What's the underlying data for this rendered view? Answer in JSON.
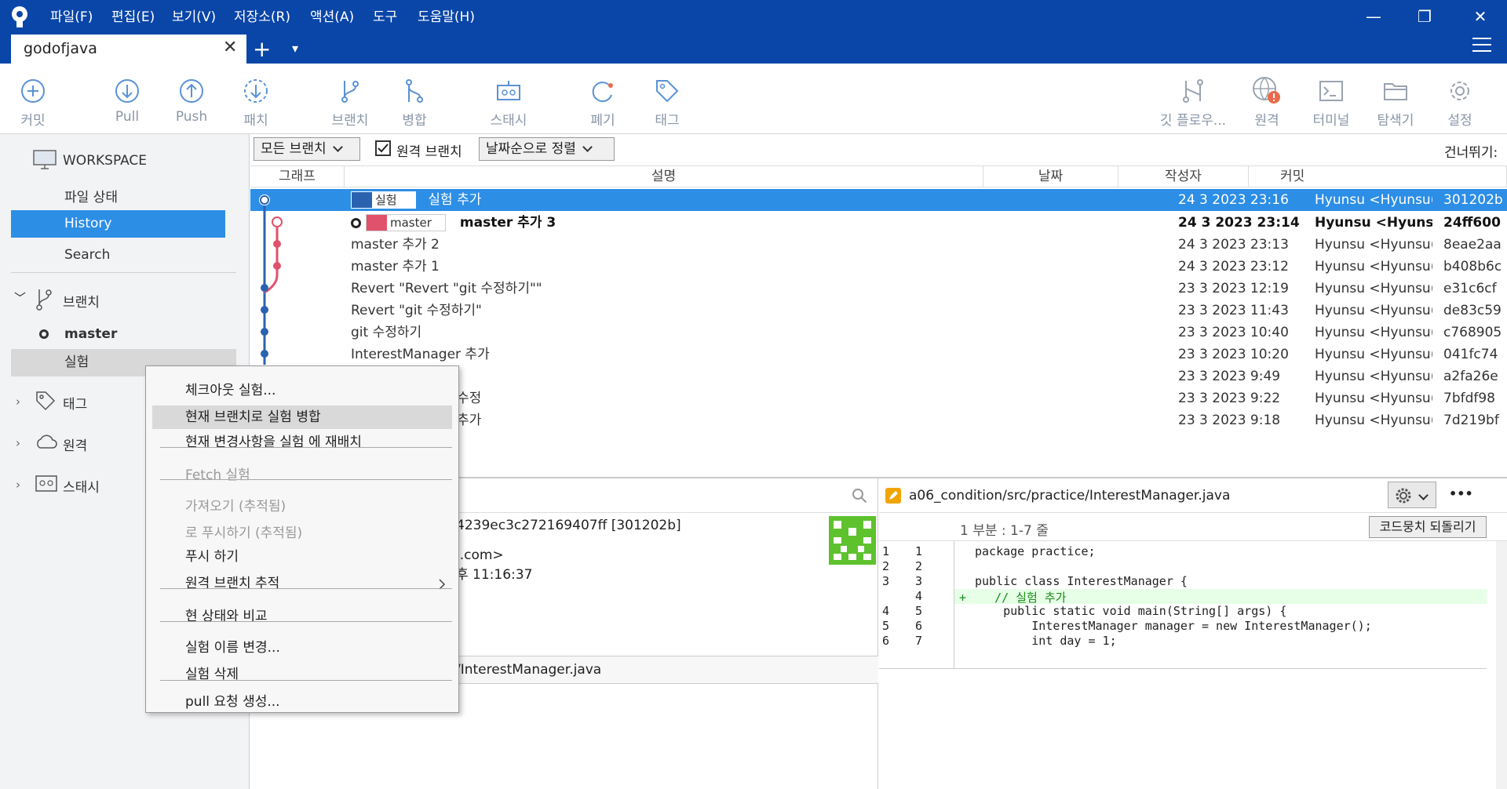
{
  "menu": [
    "파일(F)",
    "편집(E)",
    "보기(V)",
    "저장소(R)",
    "액션(A)",
    "도구",
    "도움말(H)"
  ],
  "tab": {
    "label": "godofjava",
    "close": "✕",
    "add": "+",
    "dropdown": "▾"
  },
  "window": {
    "minimize": "—",
    "restore": "❐",
    "close": "✕"
  },
  "toolbar": {
    "commit": "커밋",
    "pull": "Pull",
    "push": "Push",
    "patch": "패치",
    "branch": "브랜치",
    "merge": "병합",
    "stash": "스태시",
    "discard": "폐기",
    "tag": "태그",
    "gitflow": "깃 플로우...",
    "remote": "원격",
    "terminal": "터미널",
    "explorer": "탐색기",
    "settings": "설정"
  },
  "sidebar": {
    "workspace": "WORKSPACE",
    "file_status": "파일 상태",
    "history": "History",
    "search": "Search",
    "branches": "브랜치",
    "branch_master": "master",
    "branch_silheom": "실험",
    "tags": "태그",
    "remotes": "원격",
    "stashes": "스태시"
  },
  "filter": {
    "all_branches": "모든 브랜치",
    "remote_branches": "원격 브랜치",
    "sort": "날짜순으로 정렬",
    "skip": "건너뛰기:"
  },
  "columns": {
    "graph": "그래프",
    "description": "설명",
    "date": "날짜",
    "author": "작성자",
    "commit": "커밋"
  },
  "commits": [
    {
      "branch_tag": "실험",
      "desc": "실험 추가",
      "date": "24 3 2023 23:16",
      "author": "Hyunsu <Hyunsu(",
      "hash": "301202b"
    },
    {
      "branch_tag": "master",
      "desc": "master 추가 3",
      "date": "24 3 2023 23:14",
      "author": "Hyunsu <Hyunsu",
      "hash": "24ff600"
    },
    {
      "desc": "master 추가 2",
      "date": "24 3 2023 23:13",
      "author": "Hyunsu <Hyunsu(",
      "hash": "8eae2aa"
    },
    {
      "desc": "master 추가 1",
      "date": "24 3 2023 23:12",
      "author": "Hyunsu <Hyunsu(",
      "hash": "b408b6c"
    },
    {
      "desc": "Revert \"Revert \"git 수정하기\"\"",
      "date": "23 3 2023 12:19",
      "author": "Hyunsu <Hyunsu(",
      "hash": "e31c6cf"
    },
    {
      "desc": "Revert \"git 수정하기\"",
      "date": "23 3 2023 11:43",
      "author": "Hyunsu <Hyunsu(",
      "hash": "de83c59"
    },
    {
      "desc": "git 수정하기",
      "date": "23 3 2023 10:40",
      "author": "Hyunsu <Hyunsu(",
      "hash": "c768905"
    },
    {
      "desc": "InterestManager 추가",
      "date": "23 3 2023 10:20",
      "author": "Hyunsu <Hyunsu(",
      "hash": "041fc74"
    },
    {
      "desc": "",
      "date": "23 3 2023 9:49",
      "author": "Hyunsu <Hyunsu(",
      "hash": "a2fa26e"
    },
    {
      "desc": "수정",
      "date": "23 3 2023 9:22",
      "author": "Hyunsu <Hyunsu(",
      "hash": "7bfdf98"
    },
    {
      "desc": "추가",
      "date": "23 3 2023 9:18",
      "author": "Hyunsu <Hyunsu(",
      "hash": "7d219bf"
    }
  ],
  "details": {
    "commit_line": "4239ec3c272169407ff [301202b]",
    "email_line": "l.com>",
    "date_line": "후 11:16:37",
    "file": "/InterestManager.java"
  },
  "diff": {
    "path": "a06_condition/src/practice/InterestManager.java",
    "hunk": "1 부분 : 1-7 줄",
    "revert_button": "코드뭉치 되돌리기",
    "more": "•••",
    "lines": [
      {
        "old": "1",
        "new": "1",
        "code": "package practice;",
        "added": false
      },
      {
        "old": "2",
        "new": "2",
        "code": "",
        "added": false
      },
      {
        "old": "3",
        "new": "3",
        "code": "public class InterestManager {",
        "added": false
      },
      {
        "old": "",
        "new": "4",
        "code": "+    // 실험 추가",
        "added": true
      },
      {
        "old": "4",
        "new": "5",
        "code": "    public static void main(String[] args) {",
        "added": false
      },
      {
        "old": "5",
        "new": "6",
        "code": "        InterestManager manager = new InterestManager();",
        "added": false
      },
      {
        "old": "6",
        "new": "7",
        "code": "        int day = 1;",
        "added": false
      }
    ]
  },
  "context_menu": {
    "checkout": "체크아웃 실험...",
    "merge": "현재 브랜치로 실험 병합",
    "rebase": "현재 변경사항을 실험 에 재배치",
    "fetch": "Fetch 실험",
    "pull_tracked": "가져오기  (추적됨)",
    "push_tracked": "로 푸시하기 (추적됨)",
    "push": "푸시 하기",
    "track_remote": "원격 브랜치 추적",
    "compare": "현 상태와 비교",
    "rename": "실험 이름 변경...",
    "delete": "실험 삭제",
    "pull_request": "pull 요청 생성..."
  },
  "colors": {
    "accent": "#0a46a8",
    "selection": "#2d8ee6",
    "graph_blue": "#2b62b0",
    "graph_pink": "#e0526b",
    "added_line": "#e6ffe6"
  }
}
